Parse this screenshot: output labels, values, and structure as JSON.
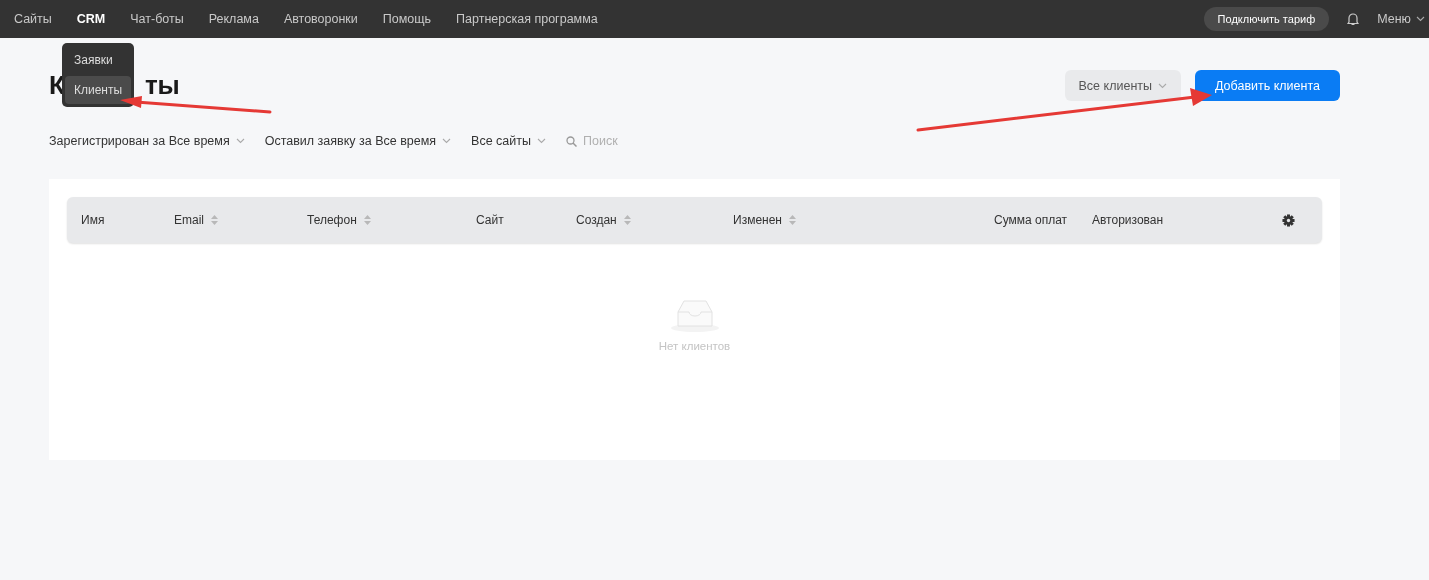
{
  "nav": {
    "items": [
      {
        "label": "Сайты",
        "selected": false
      },
      {
        "label": "CRM",
        "selected": true
      },
      {
        "label": "Чат-боты",
        "selected": false
      },
      {
        "label": "Реклама",
        "selected": false
      },
      {
        "label": "Автоворонки",
        "selected": false
      },
      {
        "label": "Помощь",
        "selected": false
      },
      {
        "label": "Партнерская программа",
        "selected": false
      }
    ],
    "tariff_button": "Подключить тариф",
    "menu": "Меню"
  },
  "crm_menu": {
    "items": [
      {
        "label": "Заявки",
        "selected": false
      },
      {
        "label": "Клиенты",
        "selected": true
      }
    ]
  },
  "title_parts": [
    "К",
    "ты"
  ],
  "client_filter": "Все клиенты",
  "add_button": "Добавить клиента",
  "filters": [
    "Зарегистрирован за Все время",
    "Оставил заявку за Все время",
    "Все сайты"
  ],
  "search": {
    "placeholder": "Поиск"
  },
  "table": {
    "columns": [
      {
        "label": "Имя",
        "sortable": false
      },
      {
        "label": "Email",
        "sortable": true
      },
      {
        "label": "Телефон",
        "sortable": true
      },
      {
        "label": "Сайт",
        "sortable": false
      },
      {
        "label": "Создан",
        "sortable": true
      },
      {
        "label": "Изменен",
        "sortable": true
      },
      {
        "label": "Сумма оплат",
        "sortable": false
      },
      {
        "label": "Авторизован",
        "sortable": false
      }
    ],
    "empty_text": "Нет клиентов"
  }
}
